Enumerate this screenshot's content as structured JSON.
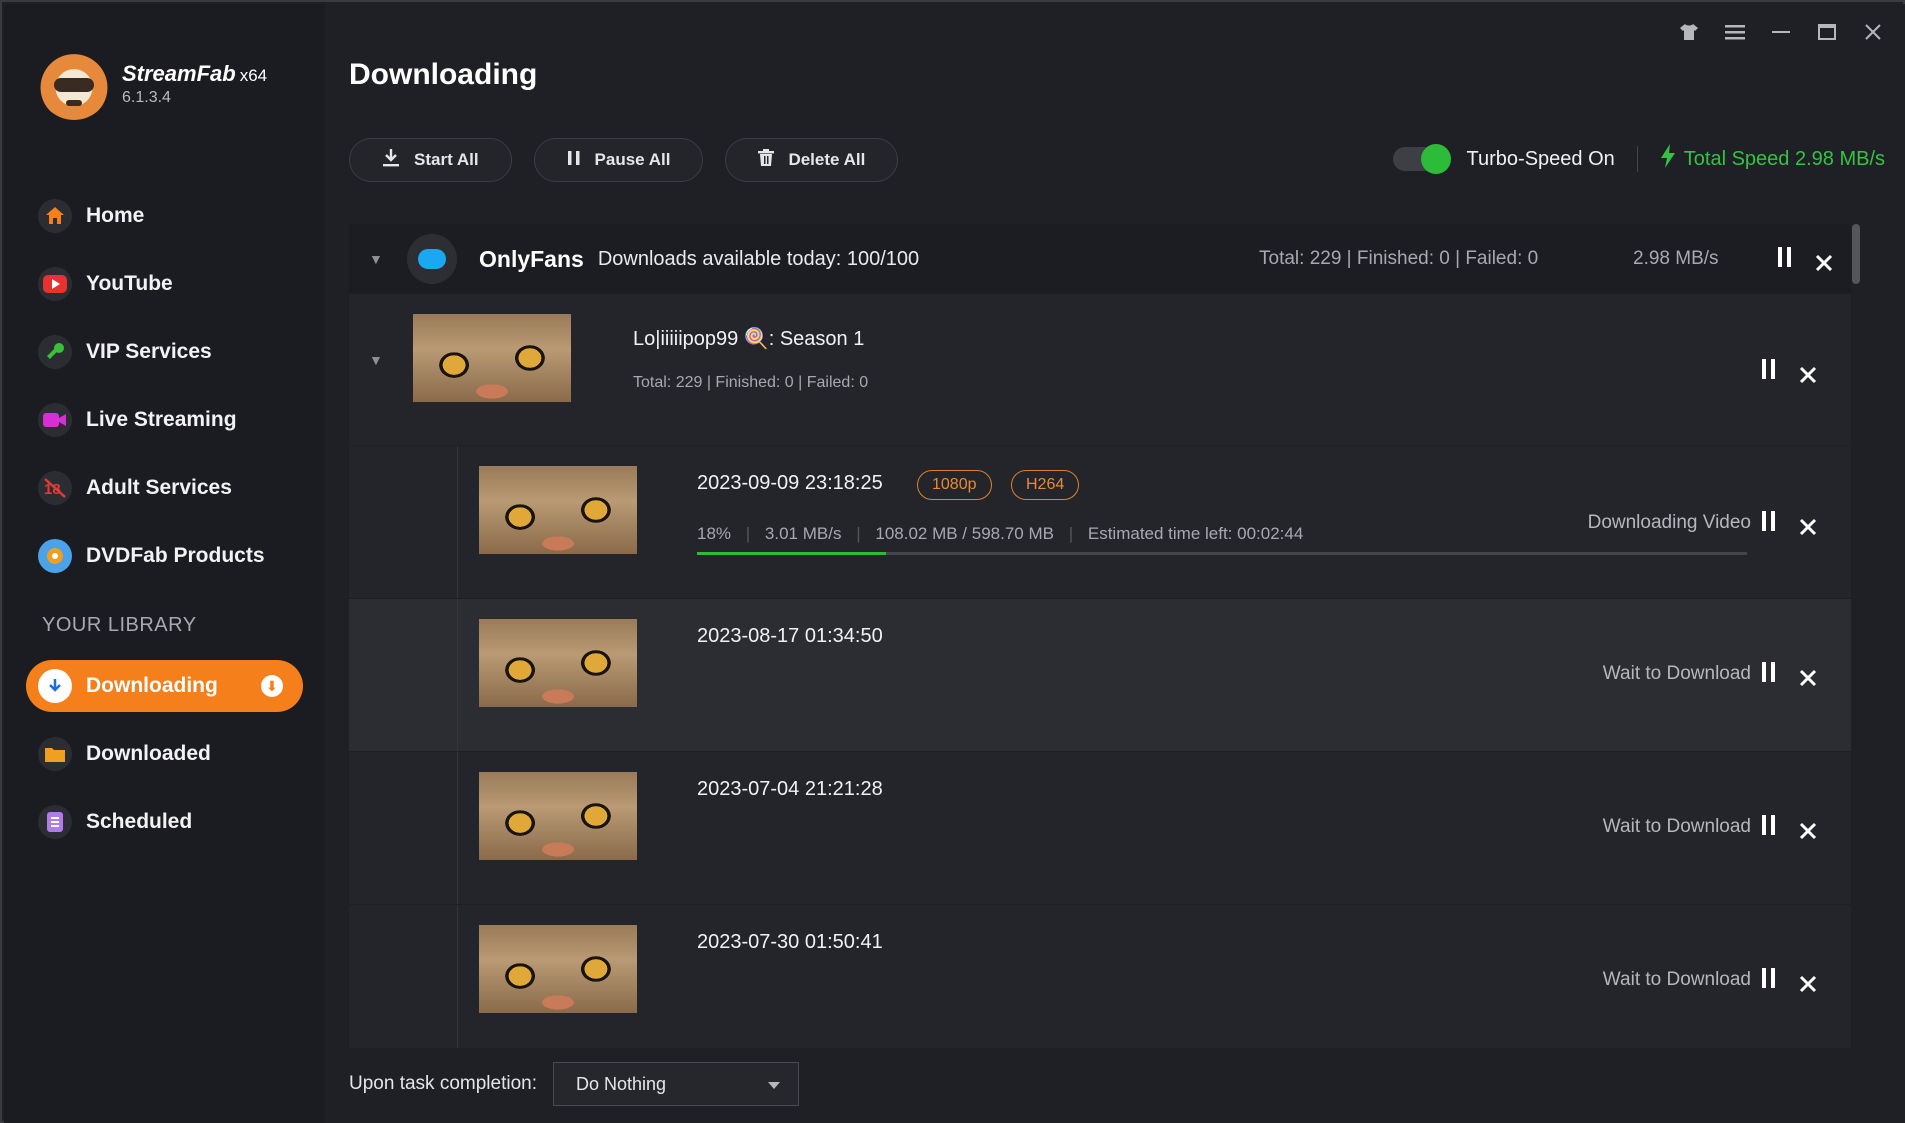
{
  "app": {
    "name": "StreamFab",
    "arch": "x64",
    "version": "6.1.3.4"
  },
  "window_controls": [
    "shirt-icon",
    "menu-icon",
    "minimize-icon",
    "maximize-icon",
    "close-icon"
  ],
  "nav": [
    {
      "label": "Home",
      "icon": "home-icon",
      "color": "#f57f1b"
    },
    {
      "label": "YouTube",
      "icon": "youtube-icon",
      "color": "#e8322f"
    },
    {
      "label": "VIP Services",
      "icon": "key-icon",
      "color": "#3cbf3a"
    },
    {
      "label": "Live Streaming",
      "icon": "camera-icon",
      "color": "#d52fd5"
    },
    {
      "label": "Adult Services",
      "icon": "adult-icon",
      "color": "#e03a3a"
    },
    {
      "label": "DVDFab Products",
      "icon": "dvdfab-icon",
      "color": "#4aa3e8"
    }
  ],
  "library": {
    "label": "YOUR LIBRARY",
    "items": [
      {
        "label": "Downloading",
        "icon": "download-icon",
        "active": true
      },
      {
        "label": "Downloaded",
        "icon": "folder-icon",
        "color": "#f0a020"
      },
      {
        "label": "Scheduled",
        "icon": "schedule-icon",
        "color": "#b07ce8"
      }
    ]
  },
  "page_title": "Downloading",
  "toolbar": {
    "start_all": "Start All",
    "pause_all": "Pause All",
    "delete_all": "Delete All"
  },
  "turbo": {
    "label": "Turbo-Speed On",
    "on": true
  },
  "total_speed": "Total Speed 2.98 MB/s",
  "group": {
    "name": "OnlyFans",
    "available": "Downloads available today: 100/100",
    "stats": "Total: 229 | Finished: 0 | Failed: 0",
    "speed": "2.98 MB/s"
  },
  "season": {
    "title": "Lo|iiiiipop99 🍭: Season 1",
    "stats": "Total: 229   |   Finished: 0   |   Failed: 0"
  },
  "items": [
    {
      "date": "2023-09-09 23:18:25",
      "tags": [
        "1080p",
        "H264"
      ],
      "percent": "18%",
      "speed": "3.01 MB/s",
      "size": "108.02 MB / 598.70 MB",
      "eta": "Estimated time left: 00:02:44",
      "progress": 0.18,
      "status": "Downloading Video"
    },
    {
      "date": "2023-08-17 01:34:50",
      "status": "Wait to Download"
    },
    {
      "date": "2023-07-04 21:21:28",
      "status": "Wait to Download"
    },
    {
      "date": "2023-07-30 01:50:41",
      "status": "Wait to Download"
    }
  ],
  "footer": {
    "label": "Upon task completion:",
    "select_value": "Do Nothing"
  }
}
